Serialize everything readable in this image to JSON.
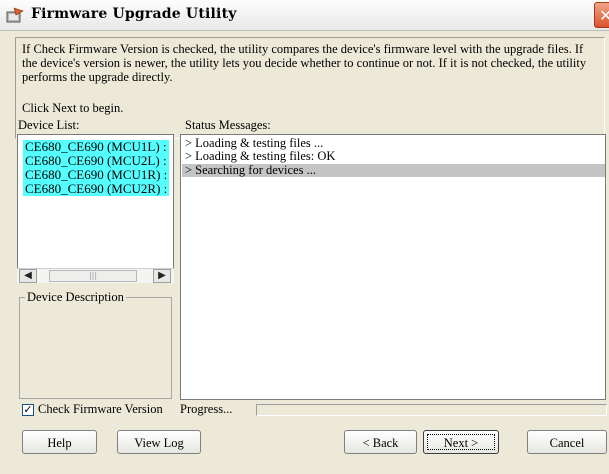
{
  "window": {
    "title": "Firmware Upgrade Utility",
    "close_glyph": "✕"
  },
  "info": {
    "description": "If Check Firmware Version is checked, the utility compares the device's firmware level with the upgrade files. If the device's version is newer, the utility lets you decide whether to continue or not. If it is not checked, the utility performs the upgrade directly.",
    "begin_prompt": "Click Next to begin."
  },
  "device_list": {
    "label": "Device List:",
    "items": [
      "CE680_CE690 (MCU1L) :",
      "CE680_CE690 (MCU2L) :",
      "CE680_CE690 (MCU1R) :",
      "CE680_CE690 (MCU2R) :"
    ],
    "scroll_left": "◀",
    "scroll_right": "▶",
    "thumb_grip": "|||"
  },
  "device_description": {
    "label": "Device Description"
  },
  "status": {
    "label": "Status Messages:",
    "lines": [
      "> Loading & testing files ...",
      "> Loading & testing files: OK",
      "> Searching for devices ..."
    ],
    "selected_index": 2
  },
  "options": {
    "check_firmware_label": "Check Firmware Version",
    "check_firmware_checked": true,
    "checkmark": "✓"
  },
  "progress": {
    "label": "Progress...",
    "value_fraction": 0
  },
  "buttons": {
    "help": "Help",
    "view_log": "View Log",
    "back": "< Back",
    "next": "Next >",
    "cancel": "Cancel"
  },
  "colors": {
    "dialog_bg": "#ece9d8",
    "device_highlight": "#55ffff",
    "status_selected": "#c4c4c4",
    "close_button": "#d9532c"
  }
}
